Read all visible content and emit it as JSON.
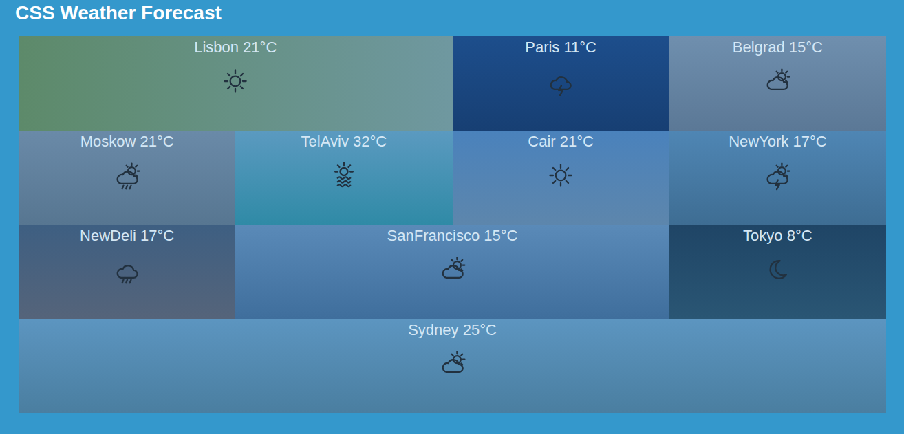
{
  "page": {
    "title": "CSS Weather Forecast"
  },
  "tiles": [
    {
      "label": "Lisbon 21°C",
      "kind": "sun"
    },
    {
      "label": "Paris 11°C",
      "kind": "storm"
    },
    {
      "label": "Belgrad 15°C",
      "kind": "cloud-sun"
    },
    {
      "label": "Moskow 21°C",
      "kind": "rain-sun"
    },
    {
      "label": "TelAviv 32°C",
      "kind": "haze"
    },
    {
      "label": "Cair 21°C",
      "kind": "sun"
    },
    {
      "label": "NewYork 17°C",
      "kind": "storm-sun"
    },
    {
      "label": "NewDeli 17°C",
      "kind": "rain"
    },
    {
      "label": "SanFrancisco 15°C",
      "kind": "cloud-sun"
    },
    {
      "label": "Tokyo 8°C",
      "kind": "moon"
    },
    {
      "label": "Sydney 25°C",
      "kind": "cloud-sun"
    }
  ]
}
